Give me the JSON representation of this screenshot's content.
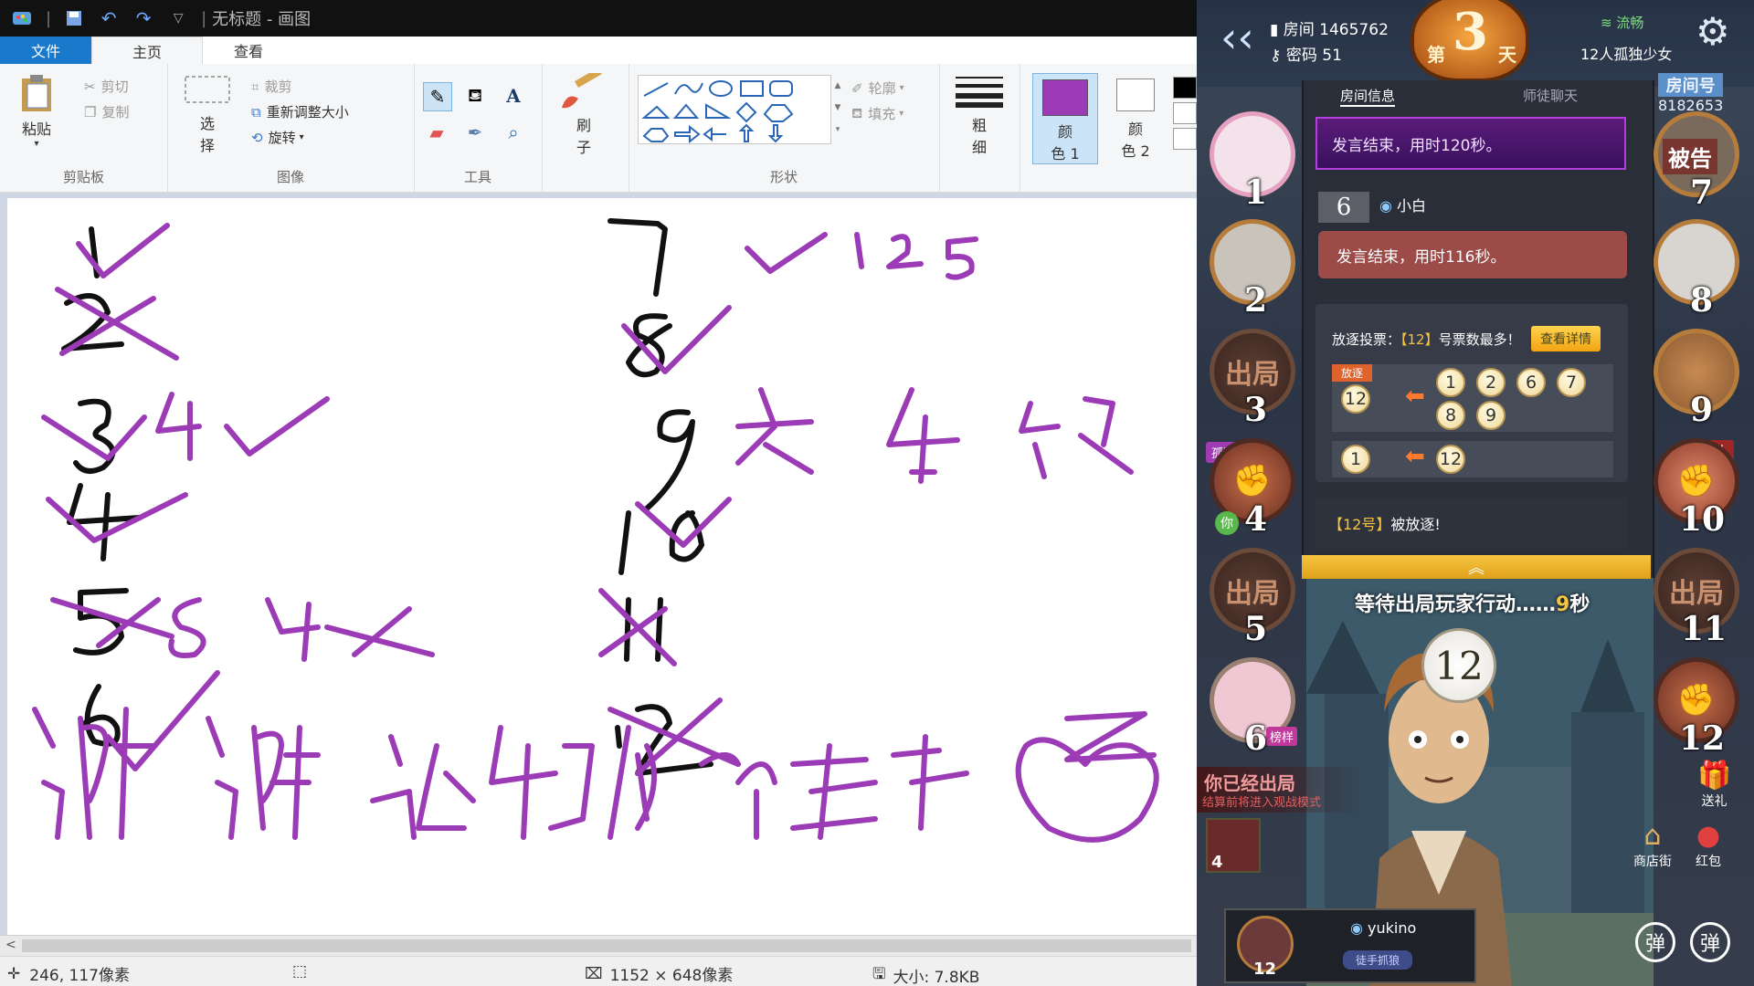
{
  "paint": {
    "title": "无标题 - 画图",
    "tabs": {
      "file": "文件",
      "home": "主页",
      "view": "查看"
    },
    "clipboard": {
      "paste": "粘贴",
      "cut": "剪切",
      "copy": "复制",
      "label": "剪贴板"
    },
    "image": {
      "select_top": "选",
      "select_bottom": "择",
      "crop": "裁剪",
      "resize": "重新调整大小",
      "rotate": "旋转",
      "label": "图像"
    },
    "tools": {
      "label": "工具"
    },
    "brushes": {
      "top": "刷",
      "bottom": "子"
    },
    "shapes": {
      "outline": "轮廓",
      "fill": "填充",
      "label": "形状"
    },
    "size": {
      "top": "粗",
      "bottom": "细"
    },
    "color1": {
      "top": "颜",
      "bottom": "色 1",
      "value": "#9b3bb6"
    },
    "color2": {
      "top": "颜",
      "bottom": "色 2"
    },
    "status": {
      "cursor": "246, 117像素",
      "dimensions": "1152 × 648像素",
      "filesize": "大小: 7.8KB"
    },
    "drawing": {
      "left_column": [
        "1",
        "2",
        "3",
        "4",
        "5",
        "6"
      ],
      "right_column": [
        "7",
        "8",
        "9",
        "10",
        "11",
        "12"
      ],
      "top_note": "8 ✓ 12 5",
      "row3_note": "4✓",
      "row5_note": "8 4X",
      "middle_words": [
        "女",
        "4",
        "银"
      ],
      "right_mark": "Z",
      "bottom_text": "谢谢礼物心车",
      "stroke_color": "#9b3bb6"
    }
  },
  "game": {
    "room": "房间 1465762",
    "password": "密码 51",
    "day_prefix": "第",
    "day_number": "3",
    "day_suffix": "天",
    "network": "流畅",
    "mode": "12人孤独少女",
    "room_number_label": "房间号",
    "room_number": "8182653",
    "tab_info": "房间信息",
    "tab_chat": "师徒聊天",
    "msg1": "发言结束，用时120秒。",
    "speaker_num": "6",
    "speaker_name": "小白",
    "msg2": "发言结束，用时116秒。",
    "vote_title_prefix": "放逐投票：",
    "vote_title_highlight": "【12】",
    "vote_title_suffix": "号票数最多！",
    "vote_detail_btn": "查看详情",
    "exile_tag": "放逐",
    "vote_target1": "12",
    "voters1": [
      "1",
      "2",
      "6",
      "7",
      "8",
      "9"
    ],
    "vote_voter2": "1",
    "vote_target2": "12",
    "exiled_prefix": "【12号】",
    "exiled_text": "被放逐!",
    "waiting_text": "等待出局玩家行动……",
    "waiting_secs": "9",
    "waiting_unit": "秒",
    "speaking_num": "12",
    "out_text": "你已经出局",
    "out_sub": "结算前将进入观战模式",
    "player_name": "yukino",
    "player_title": "徒手抓狼",
    "player_seat": "12",
    "out_label": "出局",
    "lonely_girl_tag": "孤独少女",
    "you_tag": "你",
    "wolf_tag": "狼人",
    "accused_tag": "被告",
    "role_tag": "榜样",
    "gift_label": "送礼",
    "shop_label": "商店街",
    "redpacket_label": "红包",
    "danmu_label": "弹",
    "small_seat": "4",
    "seats": [
      "1",
      "2",
      "3",
      "4",
      "5",
      "6",
      "7",
      "8",
      "9",
      "10",
      "11",
      "12"
    ]
  }
}
